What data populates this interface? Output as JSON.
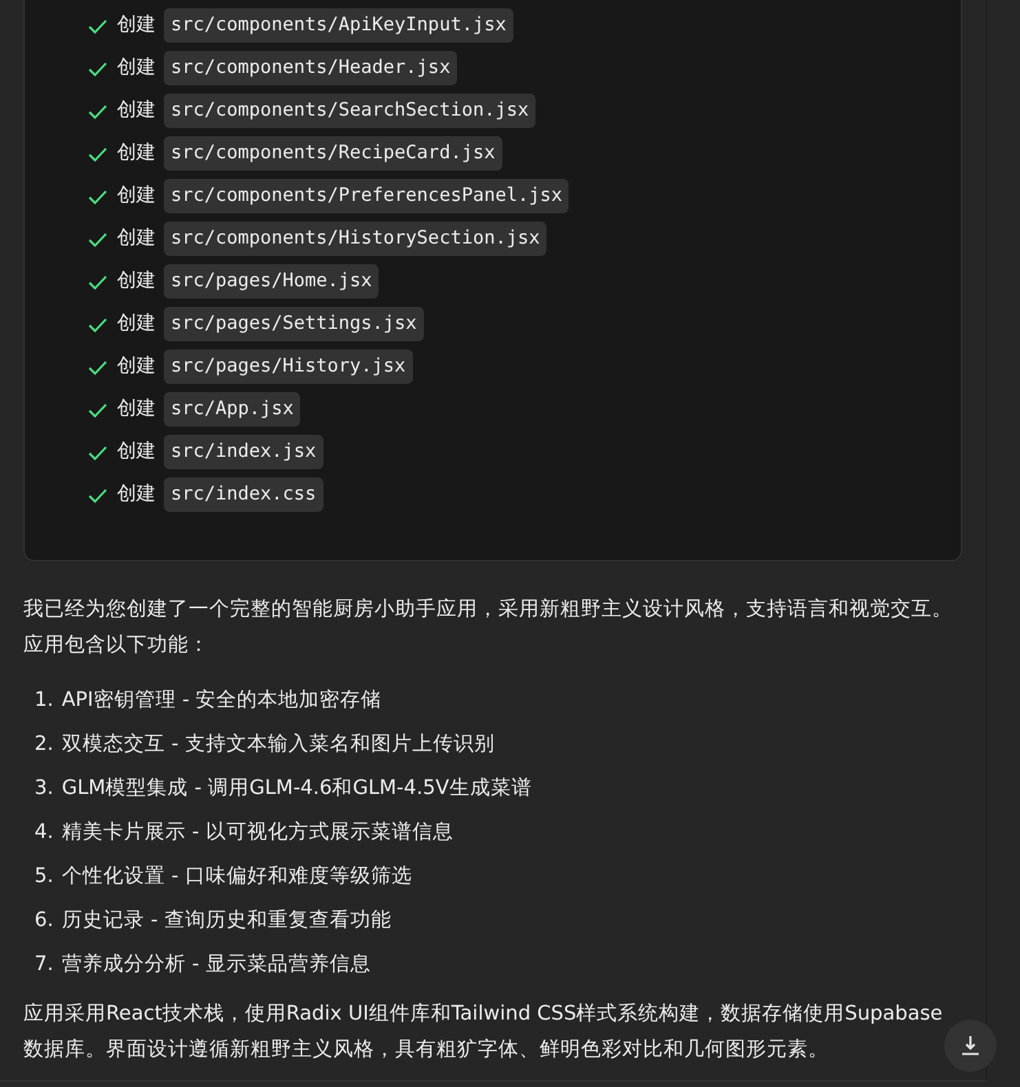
{
  "steps": [
    {
      "done": true,
      "action": "创建",
      "path": "src/components/ApiKeyInput.jsx"
    },
    {
      "done": true,
      "action": "创建",
      "path": "src/components/Header.jsx"
    },
    {
      "done": true,
      "action": "创建",
      "path": "src/components/SearchSection.jsx"
    },
    {
      "done": true,
      "action": "创建",
      "path": "src/components/RecipeCard.jsx"
    },
    {
      "done": true,
      "action": "创建",
      "path": "src/components/PreferencesPanel.jsx"
    },
    {
      "done": true,
      "action": "创建",
      "path": "src/components/HistorySection.jsx"
    },
    {
      "done": true,
      "action": "创建",
      "path": "src/pages/Home.jsx"
    },
    {
      "done": true,
      "action": "创建",
      "path": "src/pages/Settings.jsx"
    },
    {
      "done": true,
      "action": "创建",
      "path": "src/pages/History.jsx"
    },
    {
      "done": true,
      "action": "创建",
      "path": "src/App.jsx"
    },
    {
      "done": true,
      "action": "创建",
      "path": "src/index.jsx"
    },
    {
      "done": true,
      "action": "创建",
      "path": "src/index.css"
    }
  ],
  "intro": "我已经为您创建了一个完整的智能厨房小助手应用，采用新粗野主义设计风格，支持语言和视觉交互。应用包含以下功能：",
  "features": [
    {
      "number": "1.",
      "text": "API密钥管理 - 安全的本地加密存储"
    },
    {
      "number": "2.",
      "text": "双模态交互 - 支持文本输入菜名和图片上传识别"
    },
    {
      "number": "3.",
      "text": "GLM模型集成 - 调用GLM-4.6和GLM-4.5V生成菜谱"
    },
    {
      "number": "4.",
      "text": "精美卡片展示 - 以可视化方式展示菜谱信息"
    },
    {
      "number": "5.",
      "text": "个性化设置 - 口味偏好和难度等级筛选"
    },
    {
      "number": "6.",
      "text": "历史记录 - 查询历史和重复查看功能"
    },
    {
      "number": "7.",
      "text": "营养成分分析 - 显示菜品营养信息"
    }
  ],
  "summary": "应用采用React技术栈，使用Radix UI组件库和Tailwind CSS样式系统构建，数据存储使用Supabase数据库。界面设计遵循新粗野主义风格，具有粗犷字体、鲜明色彩对比和几何图形元素。"
}
